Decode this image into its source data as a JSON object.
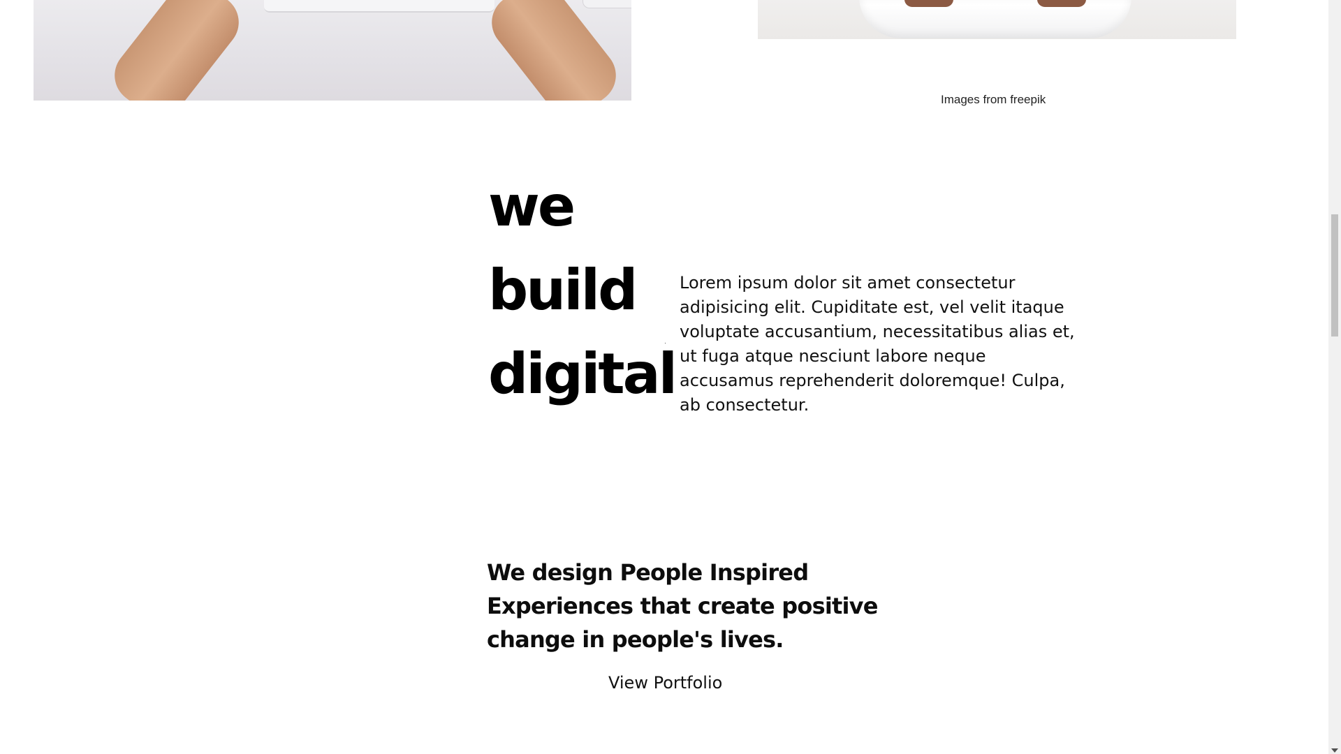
{
  "photos": {
    "left_alt": "hands on laptop photo",
    "right_alt": "person in white shirt photo"
  },
  "credit": "Images from freepik",
  "hero": {
    "words": [
      "we",
      "build",
      "digital"
    ]
  },
  "intro_text": "Lorem ipsum dolor sit amet consectetur adipisicing elit. Cupiditate est, vel velit itaque voluptate accusantium, necessitatibus alias et, ut fuga atque nesciunt labore neque accusamus reprehenderit doloremque! Culpa, ab consectetur.",
  "tagline": "We design People Inspired Experiences that create positive change in people's lives.",
  "portfolio_link": "View Portfolio",
  "colors": {
    "text": "#000000",
    "background": "#ffffff",
    "scrollbar_track": "#f1f1f1",
    "scrollbar_thumb": "#c1c1c1"
  }
}
